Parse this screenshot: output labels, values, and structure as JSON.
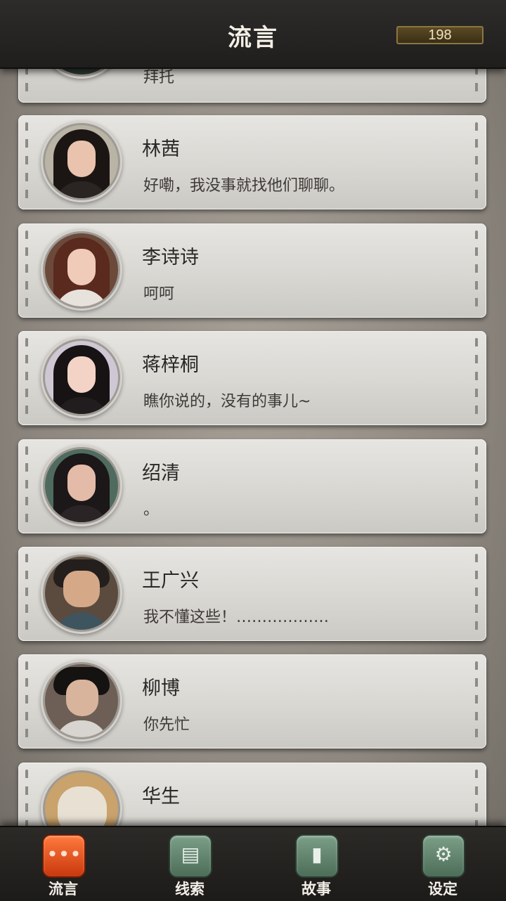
{
  "header": {
    "title": "流言",
    "coins": "198"
  },
  "partial_top": {
    "message": "拜托"
  },
  "contacts": [
    {
      "name": "林茜",
      "message": "好嘞，我没事就找他们聊聊。"
    },
    {
      "name": "李诗诗",
      "message": "呵呵"
    },
    {
      "name": "蒋梓桐",
      "message": "瞧你说的，没有的事儿~"
    },
    {
      "name": "绍清",
      "message": "。"
    },
    {
      "name": "王广兴",
      "message": "我不懂这些！………………"
    },
    {
      "name": "柳博",
      "message": "你先忙"
    },
    {
      "name": "华生",
      "message": ""
    }
  ],
  "nav": [
    {
      "label": "流言",
      "icon": "chat-bubble-icon",
      "active": true
    },
    {
      "label": "线索",
      "icon": "paper-scroll-icon",
      "active": false
    },
    {
      "label": "故事",
      "icon": "book-icon",
      "active": false
    },
    {
      "label": "设定",
      "icon": "gears-icon",
      "active": false
    }
  ],
  "colors": {
    "accent": "#e2561d",
    "nav_icon": "#5f8570",
    "card": "#dedcd8"
  }
}
